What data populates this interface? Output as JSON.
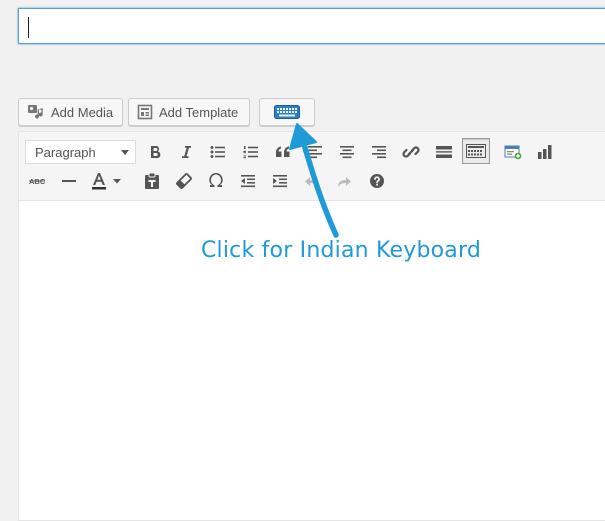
{
  "title_field": {
    "value": "",
    "placeholder": ""
  },
  "media_buttons": {
    "add_media_label": "Add Media",
    "add_template_label": "Add Template"
  },
  "toolbar": {
    "format_select_value": "Paragraph"
  },
  "annotation": {
    "text": "Click for Indian Keyboard",
    "color": "#1e9bd7"
  },
  "colors": {
    "accent": "#1e9bd7",
    "focus_border": "#5b9dd9",
    "keyboard_icon": "#2f7fc6"
  }
}
